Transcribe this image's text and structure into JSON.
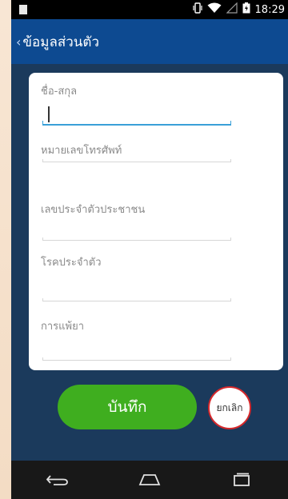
{
  "status_bar": {
    "time": "18:29"
  },
  "app_bar": {
    "back_glyph": "‹",
    "title": "ข้อมูลส่วนตัว"
  },
  "form": {
    "fields": [
      {
        "label": "ชื่อ-สกุล",
        "value": "",
        "active": true
      },
      {
        "label": "หมายเลขโทรศัพท์",
        "value": ""
      },
      {
        "label": "เลขประจำตัวประชาชน",
        "value": ""
      },
      {
        "label": "โรคประจำตัว",
        "value": ""
      },
      {
        "label": "การแพ้ยา",
        "value": ""
      }
    ]
  },
  "actions": {
    "save_label": "บันทึก",
    "cancel_label": "ยกเลิก"
  },
  "icons": {
    "status": [
      "notification-icon",
      "vibrate-icon",
      "wifi-icon",
      "signal-icon",
      "battery-icon"
    ],
    "nav": [
      "back-icon",
      "home-icon",
      "recent-apps-icon"
    ]
  }
}
